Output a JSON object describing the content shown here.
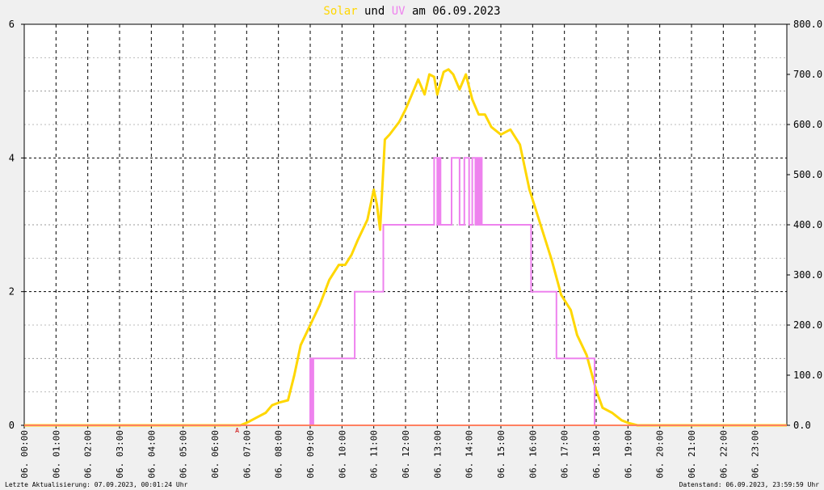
{
  "chart_data": {
    "type": "line",
    "title_parts": [
      {
        "text": "Solar",
        "color": "#ffd700"
      },
      {
        "text": " und ",
        "color": "#000000"
      },
      {
        "text": "UV",
        "color": "#ee82ee"
      },
      {
        "text": " am 06.09.2023",
        "color": "#000000"
      }
    ],
    "left_axis": {
      "ylim": [
        0,
        6
      ],
      "ticks": [
        "0",
        "2",
        "4",
        "6"
      ]
    },
    "right_axis": {
      "ylim": [
        0,
        800
      ],
      "ticks": [
        "0.0",
        "100.0",
        "200.0",
        "300.0",
        "400.0",
        "500.0",
        "600.0",
        "700.0",
        "800.0"
      ]
    },
    "x_ticks": [
      "06. 00:00",
      "06. 01:00",
      "06. 02:00",
      "06. 03:00",
      "06. 04:00",
      "06. 05:00",
      "06. 06:00",
      "06. 07:00",
      "06. 08:00",
      "06. 09:00",
      "06. 10:00",
      "06. 11:00",
      "06. 12:00",
      "06. 13:00",
      "06. 14:00",
      "06. 15:00",
      "06. 16:00",
      "06. 17:00",
      "06. 18:00",
      "06. 19:00",
      "06. 20:00",
      "06. 21:00",
      "06. 22:00",
      "06. 23:00"
    ],
    "grid": true,
    "series": [
      {
        "name": "Solar",
        "color": "#ffd700",
        "axis": "right",
        "x_hours": [
          0,
          6.8,
          7.0,
          7.3,
          7.6,
          7.8,
          8.0,
          8.3,
          8.5,
          8.7,
          9.0,
          9.3,
          9.6,
          9.9,
          10.1,
          10.3,
          10.5,
          10.8,
          11.0,
          11.1,
          11.2,
          11.35,
          11.5,
          11.8,
          12.0,
          12.2,
          12.4,
          12.6,
          12.75,
          12.9,
          13.0,
          13.2,
          13.35,
          13.5,
          13.7,
          13.9,
          14.1,
          14.3,
          14.5,
          14.7,
          15.0,
          15.3,
          15.6,
          15.9,
          16.1,
          16.3,
          16.6,
          16.9,
          17.2,
          17.4,
          17.7,
          18.0,
          18.2,
          18.5,
          18.8,
          19.0,
          19.3,
          19.6,
          19.9,
          24
        ],
        "values": [
          0,
          0,
          5,
          15,
          25,
          40,
          45,
          50,
          100,
          160,
          200,
          240,
          290,
          320,
          320,
          340,
          370,
          410,
          470,
          440,
          390,
          570,
          580,
          605,
          630,
          660,
          690,
          660,
          700,
          695,
          660,
          705,
          710,
          700,
          670,
          700,
          650,
          620,
          620,
          595,
          580,
          590,
          560,
          470,
          430,
          390,
          330,
          260,
          230,
          180,
          140,
          70,
          35,
          25,
          10,
          5,
          0,
          0,
          0,
          0
        ]
      },
      {
        "name": "UV",
        "color": "#ee82ee",
        "axis": "left",
        "step_points": [
          [
            0,
            0
          ],
          [
            9.0,
            0
          ],
          [
            9.0,
            1
          ],
          [
            9.05,
            0
          ],
          [
            9.1,
            1
          ],
          [
            10.4,
            1
          ],
          [
            10.4,
            2
          ],
          [
            11.3,
            2
          ],
          [
            11.3,
            3
          ],
          [
            12.9,
            3
          ],
          [
            12.9,
            4
          ],
          [
            13.0,
            3
          ],
          [
            13.05,
            4
          ],
          [
            13.1,
            3
          ],
          [
            13.45,
            3
          ],
          [
            13.45,
            4
          ],
          [
            13.7,
            4
          ],
          [
            13.7,
            3
          ],
          [
            13.85,
            3
          ],
          [
            13.85,
            4
          ],
          [
            14.0,
            3
          ],
          [
            14.1,
            4
          ],
          [
            14.2,
            3
          ],
          [
            14.25,
            4
          ],
          [
            14.3,
            3
          ],
          [
            14.35,
            4
          ],
          [
            14.4,
            3
          ],
          [
            15.95,
            3
          ],
          [
            15.95,
            2
          ],
          [
            16.75,
            2
          ],
          [
            16.75,
            1
          ],
          [
            17.95,
            1
          ],
          [
            17.95,
            0
          ],
          [
            24,
            0
          ]
        ]
      },
      {
        "name": "baseline",
        "color": "#ff8060",
        "axis": "left",
        "step_points": [
          [
            0,
            0
          ],
          [
            24,
            0
          ]
        ]
      }
    ]
  },
  "footer": {
    "left": "Letzte Aktualisierung: 07.09.2023, 00:01:24 Uhr",
    "right": "Datenstand: 06.09.2023, 23:59:59 Uhr"
  },
  "marker_label": "A"
}
